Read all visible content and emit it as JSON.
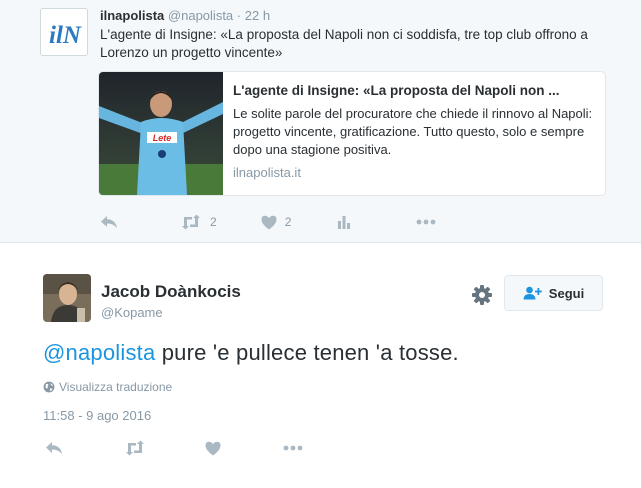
{
  "parent_tweet": {
    "author_name": "ilnapolista",
    "author_handle": "@napolista",
    "separator": "·",
    "time": "22 h",
    "avatar_text": "ilN",
    "text": "L'agente di Insigne: «La proposta del Napoli non ci soddisfa, tre top club offrono a Lorenzo un progetto vincente»",
    "card": {
      "title": "L'agente di Insigne: «La proposta del Napoli non ...",
      "description": "Le solite parole del procuratore che chiede il rinnovo al Napoli: progetto vincente, gratificazione. Tutto questo, solo e sempre dopo una stagione positiva.",
      "domain": "ilnapolista.it",
      "jersey_text": "Lete"
    },
    "retweet_count": "2",
    "like_count": "2"
  },
  "main_tweet": {
    "author_name": "Jacob Doànkocis",
    "author_handle": "@Kopame",
    "follow_label": "Segui",
    "mention": "@napolista",
    "text": " pure 'e pullece tenen 'a tosse.",
    "translate_label": "Visualizza traduzione",
    "timestamp": "11:58 - 9 ago 2016"
  },
  "colors": {
    "accent": "#1b95e0",
    "muted": "#8899a6",
    "icon": "#aab8c2",
    "parent_bg": "#f5f8fa"
  }
}
